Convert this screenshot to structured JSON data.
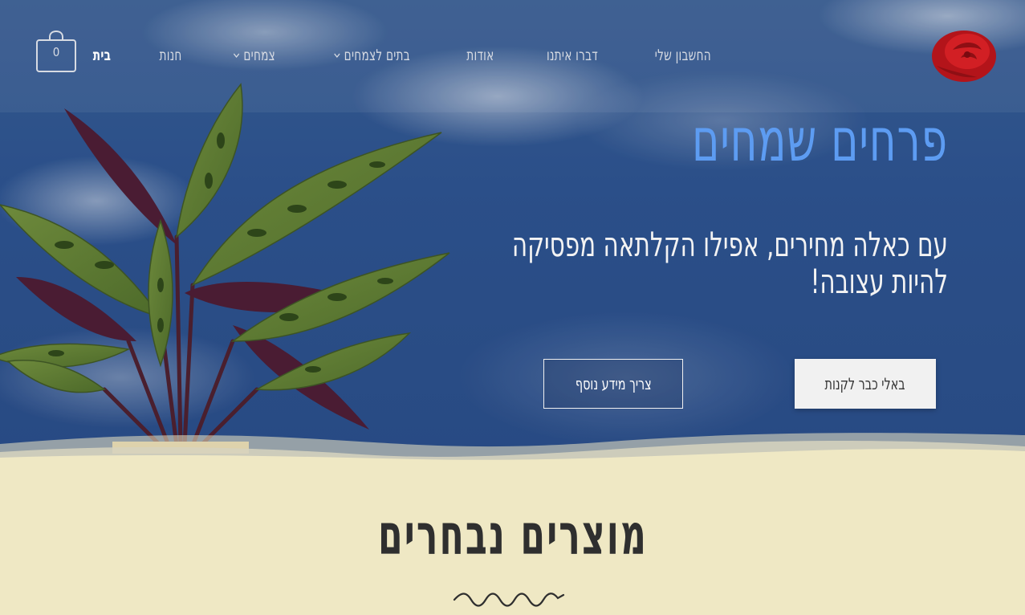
{
  "nav": {
    "items": [
      {
        "label": "בית",
        "active": true,
        "dropdown": false
      },
      {
        "label": "חנות",
        "active": false,
        "dropdown": false
      },
      {
        "label": "צמחים",
        "active": false,
        "dropdown": true
      },
      {
        "label": "בתים לצמחים",
        "active": false,
        "dropdown": true
      },
      {
        "label": "אודות",
        "active": false,
        "dropdown": false
      },
      {
        "label": "דברו איתנו",
        "active": false,
        "dropdown": false
      },
      {
        "label": "החשבון שלי",
        "active": false,
        "dropdown": false
      }
    ]
  },
  "cart": {
    "count": "0",
    "icon": "shopping-bag-icon"
  },
  "logo": {
    "icon": "red-rose-logo"
  },
  "hero": {
    "title": "פרחים שמחים",
    "subtitle": "עם כאלה מחירים, אפילו הקלתאה מפסיקה להיות עצובה!",
    "primary_button": "באלי כבר לקנות",
    "secondary_button": "צריך מידע נוסף"
  },
  "featured": {
    "title": "מוצרים נבחרים"
  },
  "colors": {
    "accent": "#5d9cf2",
    "sand": "#efe8c4",
    "sky": "#2f5591"
  }
}
